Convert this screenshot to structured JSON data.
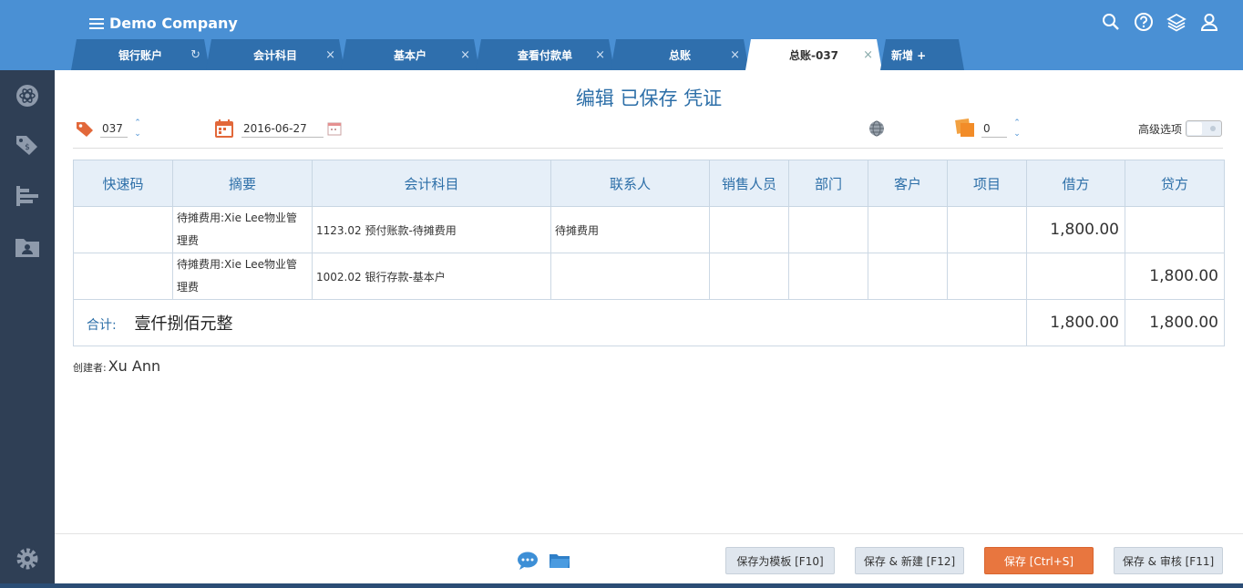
{
  "app": {
    "title": "Demo Company"
  },
  "tabs": [
    {
      "label": "银行账户",
      "close": "↻"
    },
    {
      "label": "会计科目",
      "close": "×"
    },
    {
      "label": "基本户",
      "close": "×"
    },
    {
      "label": "查看付款单",
      "close": "×"
    },
    {
      "label": "总账",
      "close": "×"
    },
    {
      "label": "总账-037",
      "close": "×"
    },
    {
      "label": "新增 +",
      "close": ""
    }
  ],
  "page": {
    "title": "编辑 已保存 凭证"
  },
  "voucher": {
    "number": "037",
    "date": "2016-06-27",
    "attachments": "0",
    "advanced_label": "高级选项"
  },
  "table": {
    "headers": [
      "快速码",
      "摘要",
      "会计科目",
      "联系人",
      "销售人员",
      "部门",
      "客户",
      "项目",
      "借方",
      "贷方"
    ],
    "rows": [
      {
        "code": "",
        "memo": "待摊费用:Xie Lee物业管理费",
        "account": "1123.02 预付账款-待摊费用",
        "contact": "待摊费用",
        "sales": "",
        "dept": "",
        "customer": "",
        "project": "",
        "debit": "1,800.00",
        "credit": ""
      },
      {
        "code": "",
        "memo": "待摊费用:Xie Lee物业管理费",
        "account": "1002.02 银行存款-基本户",
        "contact": "",
        "sales": "",
        "dept": "",
        "customer": "",
        "project": "",
        "debit": "",
        "credit": "1,800.00"
      }
    ],
    "total": {
      "label": "合计:",
      "words": "壹仟捌佰元整",
      "debit": "1,800.00",
      "credit": "1,800.00"
    }
  },
  "creator": {
    "label": "创建者:",
    "name": "Xu Ann"
  },
  "buttons": {
    "save_template": "保存为模板 [F10]",
    "save_new": "保存 & 新建 [F12]",
    "save": "保存 [Ctrl+S]",
    "save_audit": "保存 & 审核 [F11]"
  },
  "colors": {
    "header": "#4a90d4",
    "tab": "#2f6fad",
    "sidebar": "#2f3f55",
    "accent": "#2d6fa8",
    "primary_button": "#e8763f"
  }
}
